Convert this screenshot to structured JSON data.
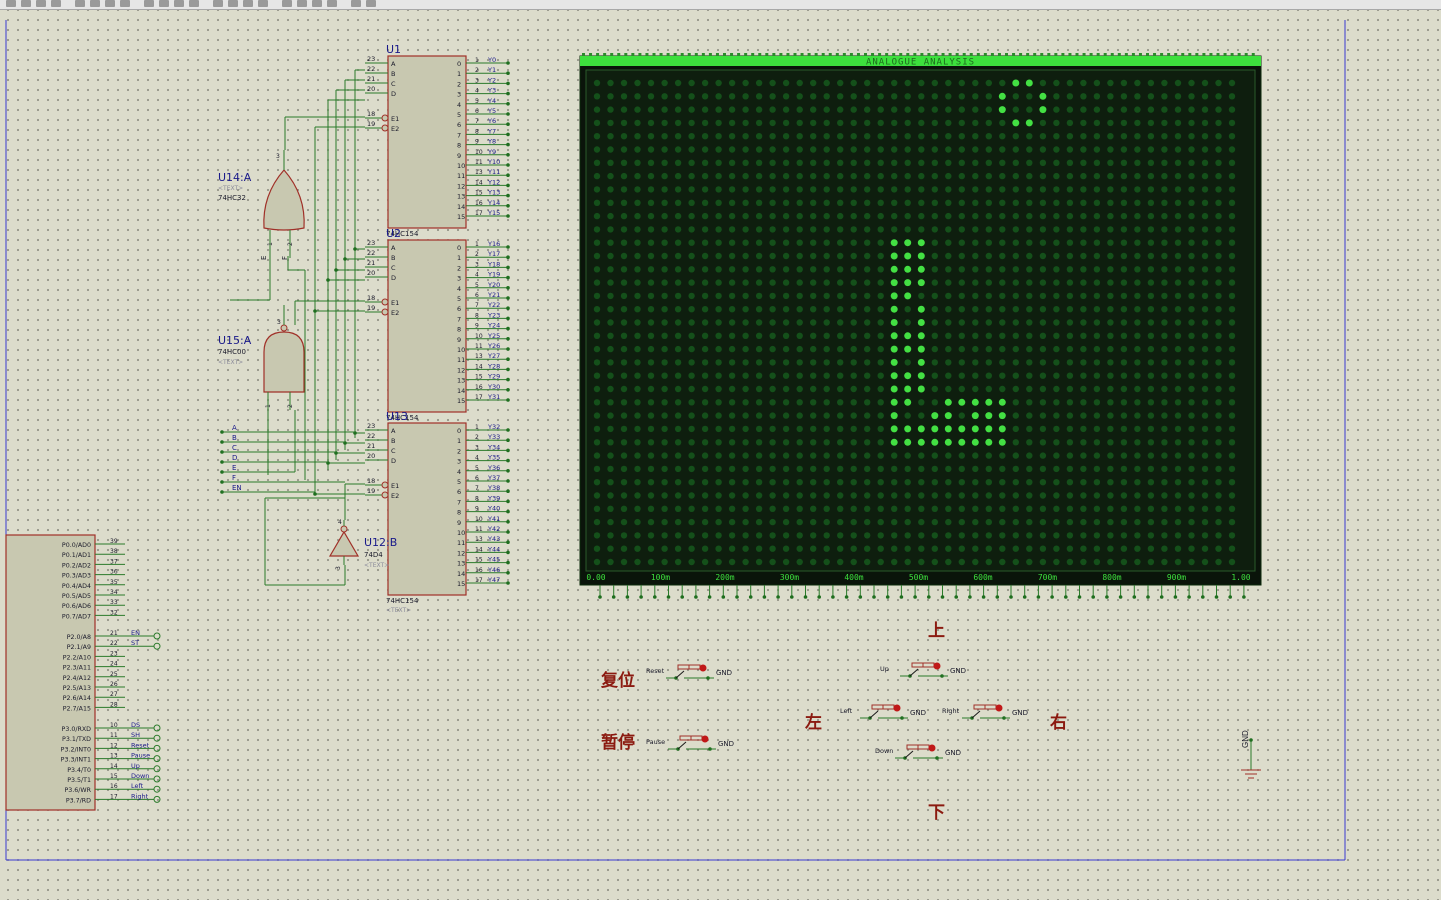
{
  "toolbar": {
    "buttons": [
      "new-icon",
      "open-icon",
      "save-icon",
      "grid-icon",
      "pointer-icon",
      "undo-icon",
      "redo-icon",
      "zoom-icon",
      "cut-icon",
      "copy-icon",
      "paste-icon",
      "block-copy-icon",
      "block-move-icon",
      "block-rotate-icon",
      "block-delete-icon",
      "pick-icon",
      "search-icon",
      "wire-icon",
      "netlist-icon",
      "bom-icon",
      "design-check-icon",
      "ares-icon"
    ]
  },
  "decoders": [
    {
      "ref": "U1",
      "part": "74HC154",
      "outputs": [
        "Y0",
        "Y1",
        "Y2",
        "Y3",
        "Y4",
        "Y5",
        "Y6",
        "Y7",
        "Y8",
        "Y9",
        "Y10",
        "Y11",
        "Y12",
        "Y13",
        "Y14",
        "Y15"
      ]
    },
    {
      "ref": "U2",
      "part": "74HC154",
      "outputs": [
        "Y16",
        "Y17",
        "Y18",
        "Y19",
        "Y20",
        "Y21",
        "Y22",
        "Y23",
        "Y24",
        "Y25",
        "Y26",
        "Y27",
        "Y28",
        "Y29",
        "Y30",
        "Y31"
      ]
    },
    {
      "ref": "U13",
      "part": "74HC154",
      "outputs": [
        "Y32",
        "Y33",
        "Y34",
        "Y35",
        "Y36",
        "Y37",
        "Y38",
        "Y39",
        "Y40",
        "Y41",
        "Y42",
        "Y43",
        "Y44",
        "Y45",
        "Y46",
        "Y47"
      ]
    }
  ],
  "decoder_pins": {
    "inputs": [
      {
        "num": "23",
        "name": "A"
      },
      {
        "num": "22",
        "name": "B"
      },
      {
        "num": "21",
        "name": "C"
      },
      {
        "num": "20",
        "name": "D"
      },
      {
        "num": "18",
        "name": "E1"
      },
      {
        "num": "19",
        "name": "E2"
      }
    ],
    "output_indices": [
      "0",
      "1",
      "2",
      "3",
      "4",
      "5",
      "6",
      "7",
      "8",
      "9",
      "10",
      "11",
      "12",
      "13",
      "14",
      "15"
    ],
    "output_pins": [
      "1",
      "2",
      "3",
      "4",
      "5",
      "6",
      "7",
      "8",
      "9",
      "10",
      "11",
      "13",
      "14",
      "15",
      "16",
      "17"
    ]
  },
  "gates": [
    {
      "ref": "U14:A",
      "part": "74HC32",
      "text": "<TEXT>",
      "pins": [
        "3",
        "E",
        "1",
        "F",
        "2"
      ]
    },
    {
      "ref": "U15:A",
      "part": "74HC00",
      "text": "<TEXT>",
      "pins": [
        "3",
        "1",
        "2"
      ]
    },
    {
      "ref": "U12:B",
      "part": "74D4",
      "text": "<TEXT>",
      "pins": [
        "4",
        "3"
      ]
    }
  ],
  "decoder_text": "<TEXT>",
  "bus_labels": [
    "A",
    "B",
    "C",
    "D",
    "E",
    "F",
    "EN"
  ],
  "mcu": {
    "port0": [
      "P0.0/AD0",
      "P0.1/AD1",
      "P0.2/AD2",
      "P0.3/AD3",
      "P0.4/AD4",
      "P0.5/AD5",
      "P0.6/AD6",
      "P0.7/AD7"
    ],
    "port0_pins": [
      "39",
      "38",
      "37",
      "36",
      "35",
      "34",
      "33",
      "32"
    ],
    "port2": [
      "P2.0/A8",
      "P2.1/A9",
      "P2.2/A10",
      "P2.3/A11",
      "P2.4/A12",
      "P2.5/A13",
      "P2.6/A14",
      "P2.7/A15"
    ],
    "port2_pins": [
      "21",
      "22",
      "23",
      "24",
      "25",
      "26",
      "27",
      "28"
    ],
    "port3": [
      "P3.0/RXD",
      "P3.1/TXD",
      "P3.2/INT0",
      "P3.3/INT1",
      "P3.4/T0",
      "P3.5/T1",
      "P3.6/WR",
      "P3.7/RD"
    ],
    "port3_pins": [
      "10",
      "11",
      "12",
      "13",
      "14",
      "15",
      "16",
      "17"
    ],
    "port2_nets": [
      "EN",
      "ST"
    ],
    "port3_nets": [
      "DS",
      "SH",
      "Reset",
      "Pause",
      "Up",
      "Down",
      "Left",
      "Right"
    ]
  },
  "analysis": {
    "title": "ANALOGUE ANALYSIS",
    "x_ticks": [
      "0.00",
      "100m",
      "200m",
      "300m",
      "400m",
      "500m",
      "600m",
      "700m",
      "800m",
      "900m",
      "1.00"
    ],
    "grid_cols": 48,
    "grid_rows": 37,
    "lit_cells": [
      [
        31,
        0
      ],
      [
        32,
        0
      ],
      [
        30,
        1
      ],
      [
        33,
        1
      ],
      [
        30,
        2
      ],
      [
        33,
        2
      ],
      [
        31,
        3
      ],
      [
        32,
        3
      ],
      [
        22,
        12
      ],
      [
        23,
        12
      ],
      [
        24,
        12
      ],
      [
        22,
        13
      ],
      [
        23,
        13
      ],
      [
        24,
        13
      ],
      [
        22,
        14
      ],
      [
        23,
        14
      ],
      [
        24,
        14
      ],
      [
        22,
        15
      ],
      [
        23,
        15
      ],
      [
        24,
        15
      ],
      [
        22,
        16
      ],
      [
        23,
        16
      ],
      [
        22,
        17
      ],
      [
        24,
        17
      ],
      [
        22,
        18
      ],
      [
        24,
        18
      ],
      [
        22,
        19
      ],
      [
        23,
        19
      ],
      [
        24,
        19
      ],
      [
        22,
        20
      ],
      [
        23,
        20
      ],
      [
        24,
        20
      ],
      [
        22,
        21
      ],
      [
        24,
        21
      ],
      [
        22,
        22
      ],
      [
        23,
        22
      ],
      [
        24,
        22
      ],
      [
        22,
        23
      ],
      [
        23,
        23
      ],
      [
        24,
        23
      ],
      [
        22,
        24
      ],
      [
        23,
        24
      ],
      [
        26,
        24
      ],
      [
        27,
        24
      ],
      [
        28,
        24
      ],
      [
        29,
        24
      ],
      [
        30,
        24
      ],
      [
        22,
        25
      ],
      [
        25,
        25
      ],
      [
        26,
        25
      ],
      [
        28,
        25
      ],
      [
        29,
        25
      ],
      [
        30,
        25
      ],
      [
        22,
        26
      ],
      [
        23,
        26
      ],
      [
        24,
        26
      ],
      [
        25,
        26
      ],
      [
        26,
        26
      ],
      [
        27,
        26
      ],
      [
        28,
        26
      ],
      [
        29,
        26
      ],
      [
        30,
        26
      ],
      [
        22,
        27
      ],
      [
        23,
        27
      ],
      [
        24,
        27
      ],
      [
        25,
        27
      ],
      [
        26,
        27
      ],
      [
        27,
        27
      ],
      [
        28,
        27
      ],
      [
        29,
        27
      ],
      [
        30,
        27
      ]
    ]
  },
  "controls": {
    "labels_cn": {
      "reset": "复位",
      "pause": "暂停",
      "up": "上",
      "down": "下",
      "left": "左",
      "right": "右"
    },
    "buttons": [
      {
        "id": "reset",
        "label": "Reset",
        "gnd": "GND"
      },
      {
        "id": "pause",
        "label": "Pause",
        "gnd": "GND"
      },
      {
        "id": "up",
        "label": "Up",
        "gnd": "GND"
      },
      {
        "id": "left",
        "label": "Left",
        "gnd": "GND"
      },
      {
        "id": "right",
        "label": "Right",
        "gnd": "GND"
      },
      {
        "id": "down",
        "label": "Down",
        "gnd": "GND"
      }
    ]
  },
  "gnd_label": "GND",
  "colors": {
    "wire": "#2a7a2a",
    "body_stroke": "#a03028",
    "body_fill": "#c8c8b0",
    "pin_dot": "#1f6e1f",
    "screen_bg": "#0c1a0c",
    "led_off": "#14501a",
    "led_on": "#43e043",
    "label_blue": "#1a1a8a",
    "accent_red": "#8b1a10",
    "sheet_border": "#3a3ad0"
  }
}
